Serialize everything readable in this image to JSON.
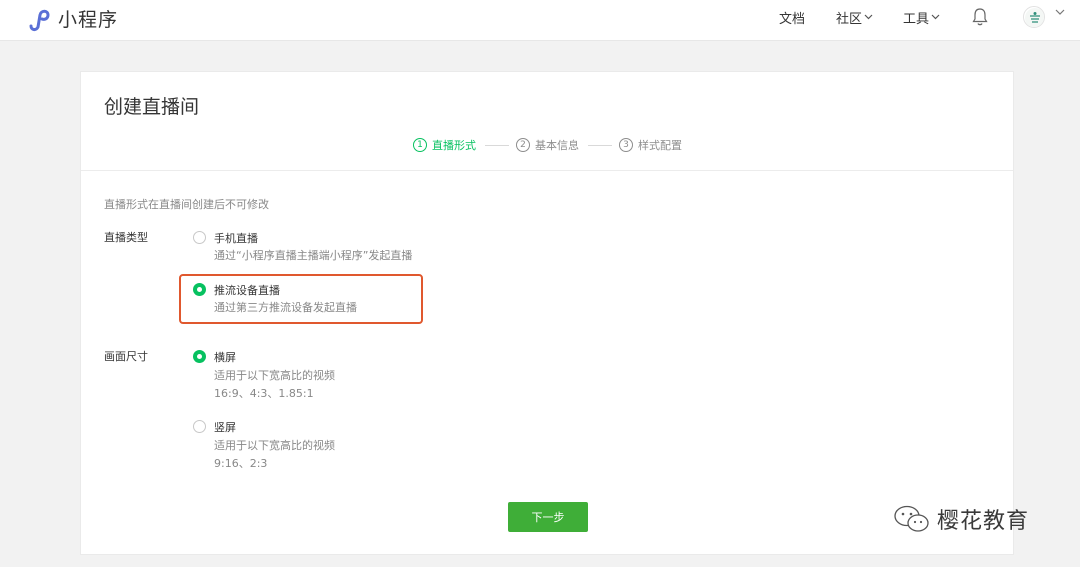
{
  "header": {
    "app_title": "小程序",
    "nav": [
      {
        "label": "文档",
        "has_dropdown": false
      },
      {
        "label": "社区",
        "has_dropdown": true
      },
      {
        "label": "工具",
        "has_dropdown": true
      }
    ],
    "icons": [
      "miniprogram-logo-icon",
      "bell-icon",
      "avatar",
      "chevron-down-icon"
    ]
  },
  "page": {
    "title": "创建直播间",
    "steps": [
      {
        "num": "1",
        "label": "直播形式",
        "active": true
      },
      {
        "num": "2",
        "label": "基本信息",
        "active": false
      },
      {
        "num": "3",
        "label": "样式配置",
        "active": false
      }
    ],
    "hint": "直播形式在直播间创建后不可修改",
    "live_type": {
      "label": "直播类型",
      "options": [
        {
          "title": "手机直播",
          "desc": "通过“小程序直播主播端小程序”发起直播",
          "checked": false
        },
        {
          "title": "推流设备直播",
          "desc": "通过第三方推流设备发起直播",
          "checked": true
        }
      ]
    },
    "screen_size": {
      "label": "画面尺寸",
      "options": [
        {
          "title": "横屏",
          "desc1": "适用于以下宽高比的视频",
          "desc2": "16:9、4:3、1.85:1",
          "checked": true
        },
        {
          "title": "竖屏",
          "desc1": "适用于以下宽高比的视频",
          "desc2": "9:16、2:3",
          "checked": false
        }
      ]
    },
    "next_button": "下一步"
  },
  "watermark": {
    "text": "樱花教育"
  },
  "colors": {
    "accent": "#07c160",
    "button": "#3fae38",
    "highlight": "#e0582e"
  }
}
